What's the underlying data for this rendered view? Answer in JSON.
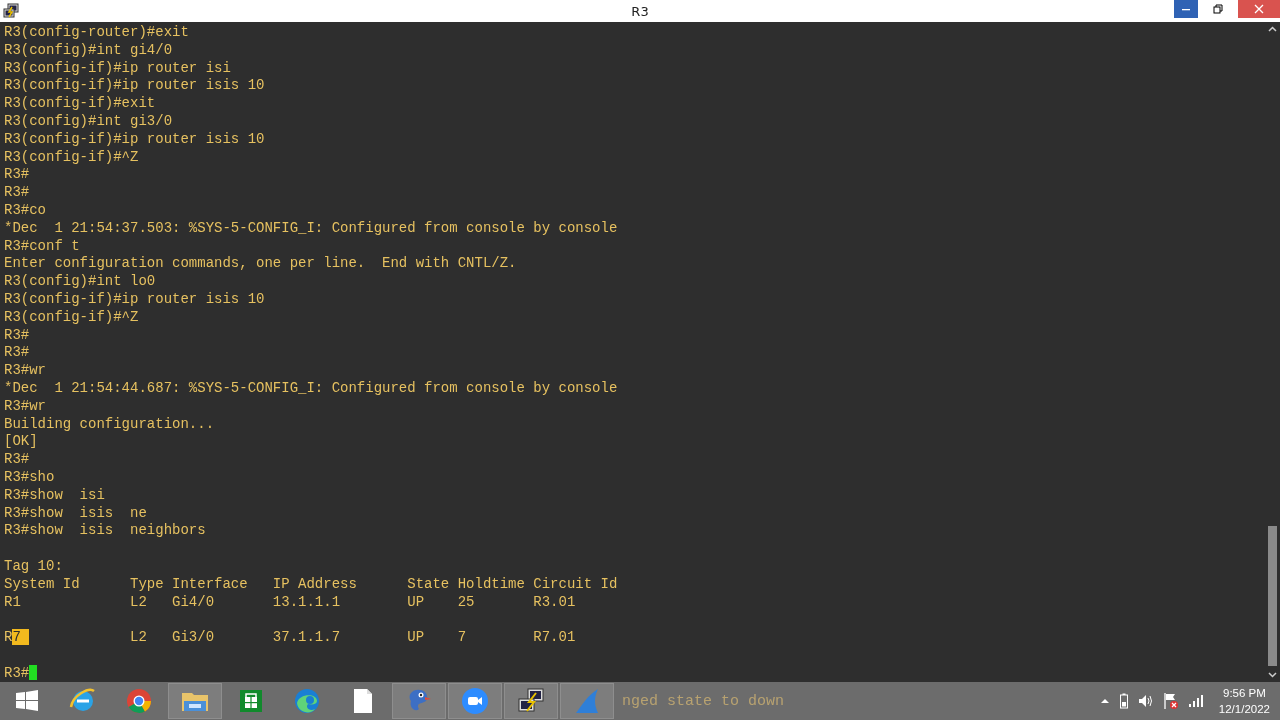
{
  "window": {
    "title": "R3",
    "minimize_hovered": true
  },
  "terminal": {
    "lines": [
      {
        "kind": "text",
        "text": "R3(config-router)#exit"
      },
      {
        "kind": "text",
        "text": "R3(config)#int gi4/0"
      },
      {
        "kind": "text",
        "text": "R3(config-if)#ip router isi"
      },
      {
        "kind": "text",
        "text": "R3(config-if)#ip router isis 10"
      },
      {
        "kind": "text",
        "text": "R3(config-if)#exit"
      },
      {
        "kind": "text",
        "text": "R3(config)#int gi3/0"
      },
      {
        "kind": "text",
        "text": "R3(config-if)#ip router isis 10"
      },
      {
        "kind": "text",
        "text": "R3(config-if)#^Z"
      },
      {
        "kind": "text",
        "text": "R3#"
      },
      {
        "kind": "text",
        "text": "R3#"
      },
      {
        "kind": "text",
        "text": "R3#co"
      },
      {
        "kind": "text",
        "text": "*Dec  1 21:54:37.503: %SYS-5-CONFIG_I: Configured from console by console"
      },
      {
        "kind": "text",
        "text": "R3#conf t"
      },
      {
        "kind": "text",
        "text": "Enter configuration commands, one per line.  End with CNTL/Z."
      },
      {
        "kind": "text",
        "text": "R3(config)#int lo0"
      },
      {
        "kind": "text",
        "text": "R3(config-if)#ip router isis 10"
      },
      {
        "kind": "text",
        "text": "R3(config-if)#^Z"
      },
      {
        "kind": "text",
        "text": "R3#"
      },
      {
        "kind": "text",
        "text": "R3#"
      },
      {
        "kind": "text",
        "text": "R3#wr"
      },
      {
        "kind": "text",
        "text": "*Dec  1 21:54:44.687: %SYS-5-CONFIG_I: Configured from console by console"
      },
      {
        "kind": "text",
        "text": "R3#wr"
      },
      {
        "kind": "text",
        "text": "Building configuration..."
      },
      {
        "kind": "text",
        "text": "[OK]"
      },
      {
        "kind": "text",
        "text": "R3#"
      },
      {
        "kind": "text",
        "text": "R3#sho"
      },
      {
        "kind": "text",
        "text": "R3#show  isi"
      },
      {
        "kind": "text",
        "text": "R3#show  isis  ne"
      },
      {
        "kind": "text",
        "text": "R3#show  isis  neighbors"
      },
      {
        "kind": "blank"
      },
      {
        "kind": "text",
        "text": "Tag 10:"
      },
      {
        "kind": "text",
        "text": "System Id      Type Interface   IP Address      State Holdtime Circuit Id"
      },
      {
        "kind": "text",
        "text": "R1             L2   Gi4/0       13.1.1.1        UP    25       R3.01"
      },
      {
        "kind": "blank"
      },
      {
        "kind": "highlight",
        "before": "R",
        "marked": "7 ",
        "after": "            L2   Gi3/0       37.1.1.7        UP    7        R7.01"
      },
      {
        "kind": "blank"
      },
      {
        "kind": "prompt",
        "text": "R3#"
      }
    ]
  },
  "taskbar": {
    "apps": [
      {
        "kind": "start",
        "running": false
      },
      {
        "kind": "ie",
        "running": false
      },
      {
        "kind": "chrome",
        "running": false
      },
      {
        "kind": "explorer",
        "running": true
      },
      {
        "kind": "store",
        "running": false
      },
      {
        "kind": "edge",
        "running": false
      },
      {
        "kind": "file",
        "running": false
      },
      {
        "kind": "dragon",
        "running": true
      },
      {
        "kind": "zoom",
        "running": true
      },
      {
        "kind": "putty",
        "running": true
      },
      {
        "kind": "shark",
        "running": true
      }
    ],
    "ghost_text": "nged state to down",
    "time": "9:56 PM",
    "date": "12/1/2022"
  }
}
